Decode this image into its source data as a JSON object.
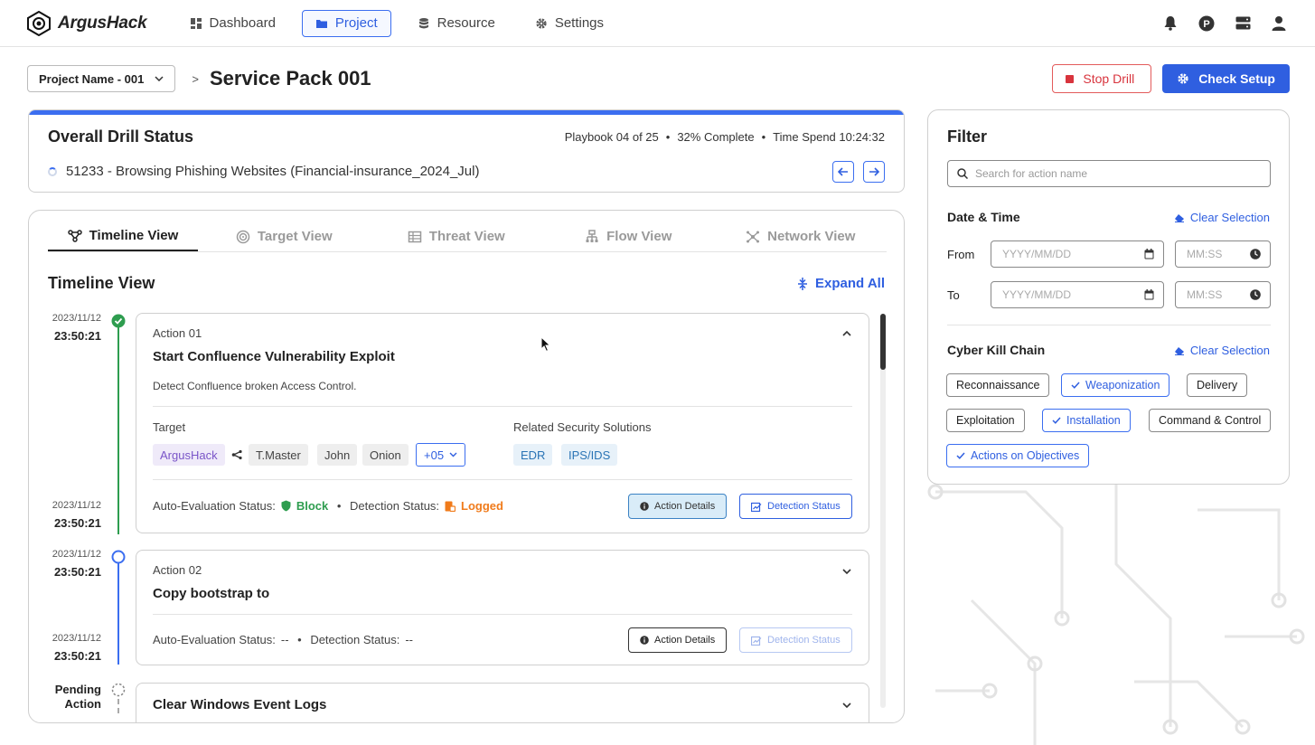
{
  "app": {
    "name": "ArgusHack"
  },
  "nav": {
    "items": [
      {
        "label": "Dashboard",
        "icon": "dashboard-icon"
      },
      {
        "label": "Project",
        "icon": "folder-icon",
        "active": true
      },
      {
        "label": "Resource",
        "icon": "database-icon"
      },
      {
        "label": "Settings",
        "icon": "gear-icon"
      }
    ],
    "right_icons": [
      "bell-icon",
      "p-badge-icon",
      "server-icon",
      "user-icon"
    ]
  },
  "header": {
    "project_select": "Project Name - 001",
    "separator": ">",
    "title": "Service Pack 001",
    "stop_label": "Stop Drill",
    "setup_label": "Check Setup"
  },
  "drill": {
    "title": "Overall Drill Status",
    "playbook": "Playbook 04 of 25",
    "complete": "32% Complete",
    "time": "Time Spend 10:24:32",
    "current": "51233 - Browsing Phishing Websites (Financial-insurance_2024_Jul)"
  },
  "tabs": [
    {
      "label": "Timeline View",
      "icon": "timeline-icon",
      "active": true
    },
    {
      "label": "Target View",
      "icon": "target-icon"
    },
    {
      "label": "Threat View",
      "icon": "table-icon"
    },
    {
      "label": "Flow View",
      "icon": "flow-icon"
    },
    {
      "label": "Network View",
      "icon": "network-icon"
    }
  ],
  "timeline": {
    "title": "Timeline View",
    "expand_all": "Expand All",
    "entries": [
      {
        "start_date": "2023/11/12",
        "start_time": "23:50:21",
        "end_date": "2023/11/12",
        "end_time": "23:50:21",
        "label": "Action 01",
        "title": "Start Confluence Vulnerability Exploit",
        "description": "Detect Confluence broken Access Control.",
        "target_label": "Target",
        "targets": [
          "ArgusHack",
          "T.Master",
          "John",
          "Onion"
        ],
        "more": "+05",
        "solutions_label": "Related Security Solutions",
        "solutions": [
          "EDR",
          "IPS/IDS"
        ],
        "auto_eval_label": "Auto-Evaluation Status:",
        "auto_eval": "Block",
        "detection_label": "Detection Status:",
        "detection": "Logged",
        "details_btn": "Action Details",
        "detect_btn": "Detection Status"
      },
      {
        "start_date": "2023/11/12",
        "start_time": "23:50:21",
        "end_date": "2023/11/12",
        "end_time": "23:50:21",
        "label": "Action 02",
        "title": "Copy bootstrap to",
        "auto_eval_label": "Auto-Evaluation Status:",
        "auto_eval": "--",
        "detection_label": "Detection Status:",
        "detection": "--",
        "details_btn": "Action Details",
        "detect_btn": "Detection Status"
      },
      {
        "pending_label": "Pending Action",
        "title": "Clear Windows Event Logs"
      }
    ]
  },
  "filter": {
    "title": "Filter",
    "search_placeholder": "Search for action name",
    "date_section": "Date & Time",
    "clear": "Clear Selection",
    "from_label": "From",
    "to_label": "To",
    "date_placeholder": "YYYY/MM/DD",
    "time_placeholder": "MM:SS",
    "kill_chain_section": "Cyber Kill Chain",
    "kill_chain": [
      {
        "label": "Reconnaissance",
        "selected": false
      },
      {
        "label": "Weaponization",
        "selected": true
      },
      {
        "label": "Delivery",
        "selected": false
      },
      {
        "label": "Exploitation",
        "selected": false
      },
      {
        "label": "Installation",
        "selected": true
      },
      {
        "label": "Command & Control",
        "selected": false
      },
      {
        "label": "Actions on Objectives",
        "selected": true
      }
    ]
  },
  "colors": {
    "accent": "#2f5fe0",
    "danger": "#d8343d",
    "success": "#2e9d4f",
    "warning": "#f07b1b"
  }
}
